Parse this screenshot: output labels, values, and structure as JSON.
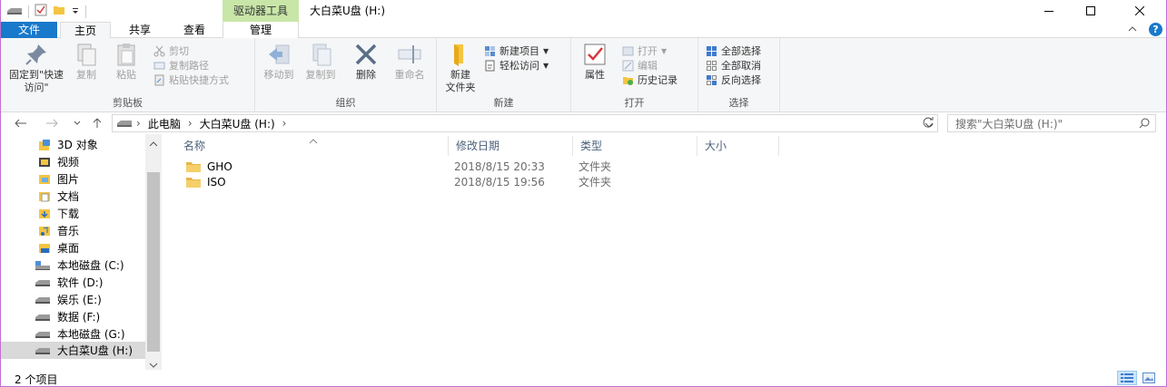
{
  "window": {
    "title": "大白菜U盘 (H:)",
    "context_tab": "驱动器工具"
  },
  "tabs": {
    "file": "文件",
    "home": "主页",
    "share": "共享",
    "view": "查看",
    "manage": "管理"
  },
  "ribbon": {
    "clipboard": {
      "label": "剪贴板",
      "pin": "固定到\"快速访问\"",
      "copy": "复制",
      "paste": "粘贴",
      "cut": "剪切",
      "copy_path": "复制路径",
      "paste_shortcut": "粘贴快捷方式"
    },
    "organize": {
      "label": "组织",
      "move_to": "移动到",
      "copy_to": "复制到",
      "delete": "删除",
      "rename": "重命名"
    },
    "new": {
      "label": "新建",
      "new_folder": "新建\n文件夹",
      "new_item": "新建项目",
      "easy_access": "轻松访问"
    },
    "open": {
      "label": "打开",
      "properties": "属性",
      "open": "打开",
      "edit": "编辑",
      "history": "历史记录"
    },
    "select": {
      "label": "选择",
      "select_all": "全部选择",
      "select_none": "全部取消",
      "invert": "反向选择"
    }
  },
  "address": {
    "crumbs": [
      "此电脑",
      "大白菜U盘 (H:)"
    ],
    "search_placeholder": "搜索\"大白菜U盘 (H:)\""
  },
  "nav_items": [
    {
      "label": "3D 对象",
      "icon": "3d-objects-icon"
    },
    {
      "label": "视频",
      "icon": "videos-icon"
    },
    {
      "label": "图片",
      "icon": "pictures-icon"
    },
    {
      "label": "文档",
      "icon": "documents-icon"
    },
    {
      "label": "下载",
      "icon": "downloads-icon"
    },
    {
      "label": "音乐",
      "icon": "music-icon"
    },
    {
      "label": "桌面",
      "icon": "desktop-icon"
    },
    {
      "label": "本地磁盘 (C:)",
      "icon": "system-drive-icon"
    },
    {
      "label": "软件 (D:)",
      "icon": "drive-icon"
    },
    {
      "label": "娱乐 (E:)",
      "icon": "drive-icon"
    },
    {
      "label": "数据 (F:)",
      "icon": "drive-icon"
    },
    {
      "label": "本地磁盘 (G:)",
      "icon": "drive-icon"
    },
    {
      "label": "大白菜U盘 (H:)",
      "icon": "usb-drive-icon",
      "selected": true
    }
  ],
  "columns": {
    "name": "名称",
    "modified": "修改日期",
    "type": "类型",
    "size": "大小"
  },
  "files": [
    {
      "name": "GHO",
      "modified": "2018/8/15 20:33",
      "type": "文件夹",
      "size": ""
    },
    {
      "name": "ISO",
      "modified": "2018/8/15 19:56",
      "type": "文件夹",
      "size": ""
    }
  ],
  "status": {
    "item_count": "2 个项目"
  }
}
